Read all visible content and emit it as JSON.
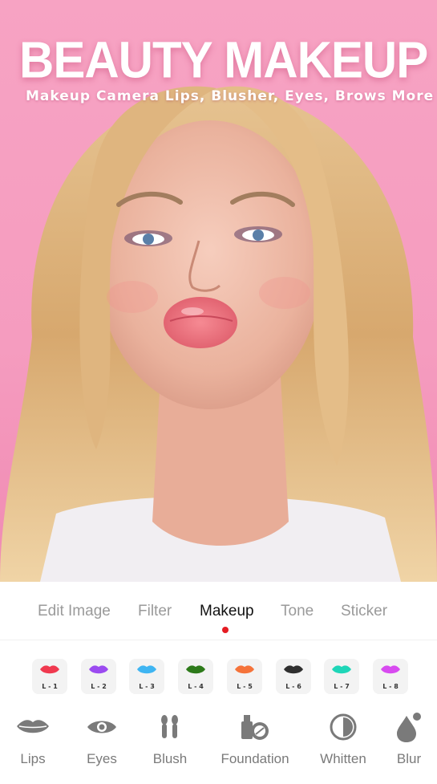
{
  "hero": {
    "headline": "BEAUTY MAKEUP",
    "tagline": "Makeup Camera  Lips, Blusher, Eyes, Brows More"
  },
  "tabs": [
    {
      "label": "Edit Image",
      "active": false
    },
    {
      "label": "Filter",
      "active": false
    },
    {
      "label": "Makeup",
      "active": true
    },
    {
      "label": "Tone",
      "active": false
    },
    {
      "label": "Sticker",
      "active": false
    }
  ],
  "swatches": [
    {
      "label": "L - 1",
      "color": "#f0394f"
    },
    {
      "label": "L - 2",
      "color": "#9b4bf0"
    },
    {
      "label": "L - 3",
      "color": "#3fb5f2"
    },
    {
      "label": "L - 4",
      "color": "#2d7a1a"
    },
    {
      "label": "L - 5",
      "color": "#f5733a"
    },
    {
      "label": "L - 6",
      "color": "#2f2f2f"
    },
    {
      "label": "L - 7",
      "color": "#1fd6b8"
    },
    {
      "label": "L - 8",
      "color": "#d84bf0"
    }
  ],
  "tools": [
    {
      "label": "Lips",
      "icon": "lips-icon"
    },
    {
      "label": "Eyes",
      "icon": "eye-icon"
    },
    {
      "label": "Blush",
      "icon": "brush-icon"
    },
    {
      "label": "Foundation",
      "icon": "foundation-icon"
    },
    {
      "label": "Whitten",
      "icon": "contrast-icon"
    },
    {
      "label": "Blur",
      "icon": "drop-icon"
    }
  ],
  "colors": {
    "accent": "#e51c23",
    "background_pink": "#f59cbf",
    "icon_gray": "#7a7a7a"
  }
}
